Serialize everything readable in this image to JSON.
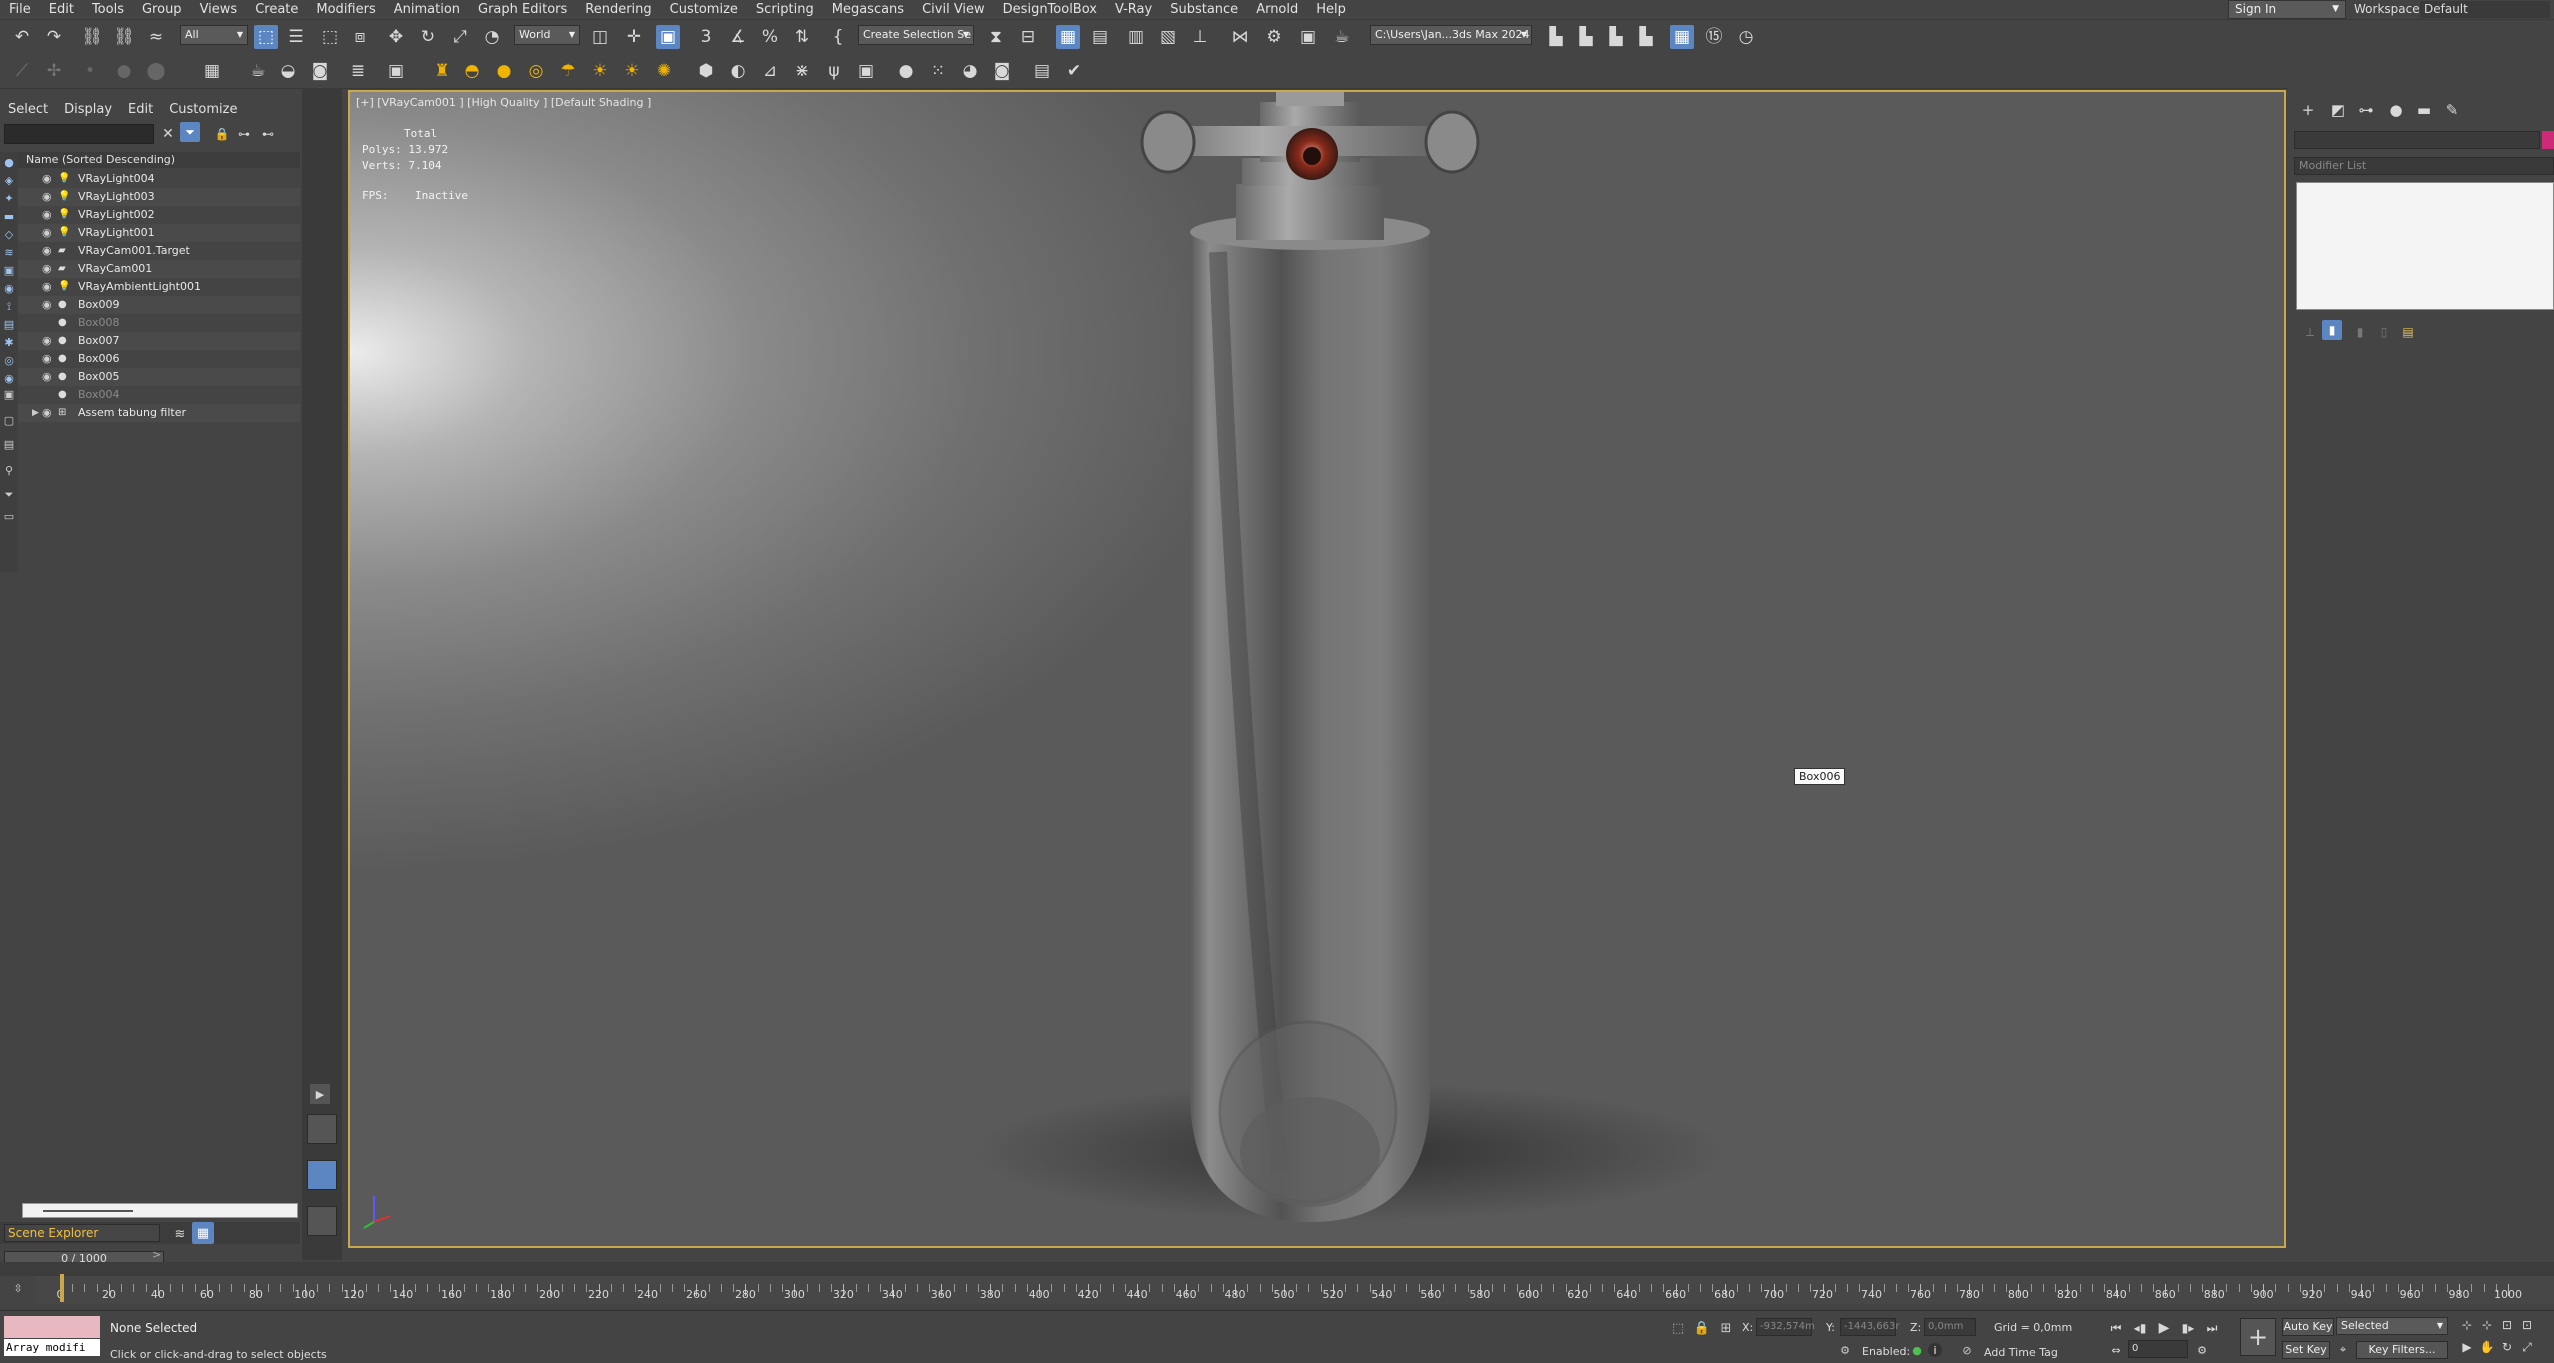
{
  "menubar": {
    "items": [
      "File",
      "Edit",
      "Tools",
      "Group",
      "Views",
      "Create",
      "Modifiers",
      "Animation",
      "Graph Editors",
      "Rendering",
      "Customize",
      "Scripting",
      "Megascans",
      "Civil View",
      "DesignToolBox",
      "V-Ray",
      "Substance",
      "Arnold",
      "Help"
    ],
    "sign_in": "Sign In",
    "workspaces_label": "Workspaces:",
    "workspaces_value": "Default"
  },
  "toolbar": {
    "selection_filter": "All",
    "reference_coord": "World",
    "selection_set": "Create Selection Se",
    "project_path": "C:\\Users\\Jan...3ds Max 2024"
  },
  "scene_explorer": {
    "tabs": [
      "Select",
      "Display",
      "Edit",
      "Customize"
    ],
    "header": "Name (Sorted Descending)",
    "rows": [
      {
        "name": "VRayLight004",
        "icon": "light-icon",
        "dim": false
      },
      {
        "name": "VRayLight003",
        "icon": "light-icon",
        "dim": false
      },
      {
        "name": "VRayLight002",
        "icon": "light-icon",
        "dim": false
      },
      {
        "name": "VRayLight001",
        "icon": "light-icon",
        "dim": false
      },
      {
        "name": "VRayCam001.Target",
        "icon": "camera-icon",
        "dim": false
      },
      {
        "name": "VRayCam001",
        "icon": "camera-icon",
        "dim": false
      },
      {
        "name": "VRayAmbientLight001",
        "icon": "light-icon",
        "dim": false
      },
      {
        "name": "Box009",
        "icon": "geometry-icon",
        "dim": false
      },
      {
        "name": "Box008",
        "icon": "geometry-icon",
        "dim": true
      },
      {
        "name": "Box007",
        "icon": "geometry-icon",
        "dim": false
      },
      {
        "name": "Box006",
        "icon": "geometry-icon",
        "dim": false
      },
      {
        "name": "Box005",
        "icon": "geometry-icon",
        "dim": false
      },
      {
        "name": "Box004",
        "icon": "geometry-icon",
        "dim": true
      },
      {
        "name": "Assem tabung filter",
        "icon": "group-icon",
        "dim": false
      }
    ],
    "explorer_name": "Scene Explorer",
    "frame_counter": "0 / 1000"
  },
  "viewport": {
    "label": "[+] [VRayCam001 ] [High Quality ] [Default Shading ]",
    "stats_total": "Total",
    "polys_label": "Polys:",
    "polys_value": "13.972",
    "verts_label": "Verts:",
    "verts_value": "7.104",
    "fps_label": "FPS:",
    "fps_value": "Inactive",
    "tooltip": "Box006"
  },
  "command_panel": {
    "modifier_list": "Modifier List"
  },
  "timeline": {
    "ticks": [
      0,
      20,
      40,
      60,
      80,
      100,
      120,
      140,
      160,
      180,
      200,
      220,
      240,
      260,
      280,
      300,
      320,
      340,
      360,
      380,
      400,
      420,
      440,
      460,
      480,
      500,
      520,
      540,
      560,
      580,
      600,
      620,
      640,
      660,
      680,
      700,
      720,
      740,
      760,
      780,
      800,
      820,
      840,
      860,
      880,
      900,
      920,
      940,
      960,
      980,
      1000
    ],
    "max_frame": 1000
  },
  "statusbar": {
    "maxscript": "Array modifi",
    "selection_status": "None Selected",
    "prompt": "Click or click-and-drag to select objects",
    "x_label": "X:",
    "x_value": "-932,574m",
    "y_label": "Y:",
    "y_value": "-1443,663r",
    "z_label": "Z:",
    "z_value": "0,0mm",
    "grid": "Grid = 0,0mm",
    "enabled": "Enabled:",
    "add_time_tag": "Add Time Tag",
    "auto_key": "Auto Key",
    "set_key": "Set Key",
    "key_mode": "Selected",
    "key_filters": "Key Filters...",
    "current_frame": "0"
  }
}
